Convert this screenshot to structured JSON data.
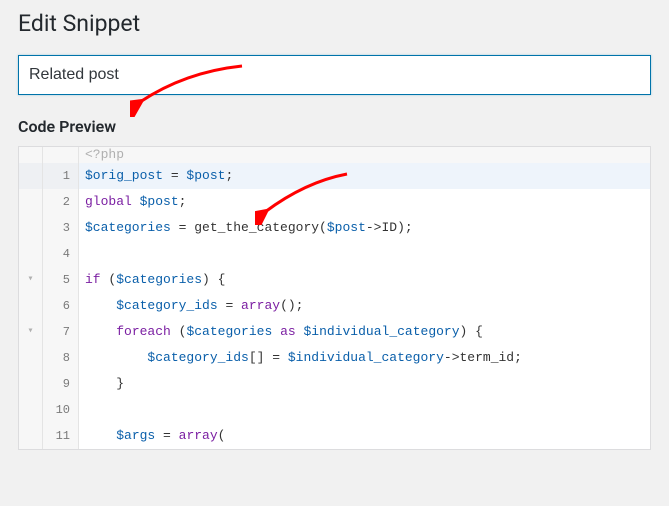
{
  "header": {
    "title": "Edit Snippet"
  },
  "snippet": {
    "name_value": "Related post"
  },
  "preview": {
    "heading": "Code Preview"
  },
  "code": {
    "readonly_prefix": "<?php",
    "lines": [
      {
        "n": 1,
        "hl": true,
        "fold": "",
        "tokens": [
          {
            "t": "var",
            "v": "$orig_post"
          },
          {
            "t": "plain",
            "v": " = "
          },
          {
            "t": "var",
            "v": "$post"
          },
          {
            "t": "plain",
            "v": ";"
          }
        ]
      },
      {
        "n": 2,
        "hl": false,
        "fold": "",
        "tokens": [
          {
            "t": "kw",
            "v": "global"
          },
          {
            "t": "plain",
            "v": " "
          },
          {
            "t": "var",
            "v": "$post"
          },
          {
            "t": "plain",
            "v": ";"
          }
        ]
      },
      {
        "n": 3,
        "hl": false,
        "fold": "",
        "tokens": [
          {
            "t": "var",
            "v": "$categories"
          },
          {
            "t": "plain",
            "v": " = get_the_category("
          },
          {
            "t": "var",
            "v": "$post"
          },
          {
            "t": "plain",
            "v": "->ID);"
          }
        ]
      },
      {
        "n": 4,
        "hl": false,
        "fold": "",
        "tokens": [
          {
            "t": "plain",
            "v": ""
          }
        ]
      },
      {
        "n": 5,
        "hl": false,
        "fold": "▾",
        "tokens": [
          {
            "t": "kw",
            "v": "if"
          },
          {
            "t": "plain",
            "v": " ("
          },
          {
            "t": "var",
            "v": "$categories"
          },
          {
            "t": "plain",
            "v": ") {"
          }
        ]
      },
      {
        "n": 6,
        "hl": false,
        "fold": "",
        "tokens": [
          {
            "t": "plain",
            "v": "    "
          },
          {
            "t": "var",
            "v": "$category_ids"
          },
          {
            "t": "plain",
            "v": " = "
          },
          {
            "t": "kw",
            "v": "array"
          },
          {
            "t": "plain",
            "v": "();"
          }
        ]
      },
      {
        "n": 7,
        "hl": false,
        "fold": "▾",
        "tokens": [
          {
            "t": "plain",
            "v": "    "
          },
          {
            "t": "kw",
            "v": "foreach"
          },
          {
            "t": "plain",
            "v": " ("
          },
          {
            "t": "var",
            "v": "$categories"
          },
          {
            "t": "plain",
            "v": " "
          },
          {
            "t": "kw",
            "v": "as"
          },
          {
            "t": "plain",
            "v": " "
          },
          {
            "t": "var",
            "v": "$individual_category"
          },
          {
            "t": "plain",
            "v": ") {"
          }
        ]
      },
      {
        "n": 8,
        "hl": false,
        "fold": "",
        "tokens": [
          {
            "t": "plain",
            "v": "        "
          },
          {
            "t": "var",
            "v": "$category_ids"
          },
          {
            "t": "plain",
            "v": "[] = "
          },
          {
            "t": "var",
            "v": "$individual_category"
          },
          {
            "t": "plain",
            "v": "->term_id;"
          }
        ]
      },
      {
        "n": 9,
        "hl": false,
        "fold": "",
        "tokens": [
          {
            "t": "plain",
            "v": "    }"
          }
        ]
      },
      {
        "n": 10,
        "hl": false,
        "fold": "",
        "tokens": [
          {
            "t": "plain",
            "v": ""
          }
        ]
      },
      {
        "n": 11,
        "hl": false,
        "fold": "",
        "tokens": [
          {
            "t": "plain",
            "v": "    "
          },
          {
            "t": "var",
            "v": "$args"
          },
          {
            "t": "plain",
            "v": " = "
          },
          {
            "t": "kw",
            "v": "array"
          },
          {
            "t": "plain",
            "v": "("
          }
        ]
      }
    ]
  },
  "annotations": {
    "arrow1": {
      "semantic": "points at snippet name input"
    },
    "arrow2": {
      "semantic": "points at first code line"
    }
  }
}
